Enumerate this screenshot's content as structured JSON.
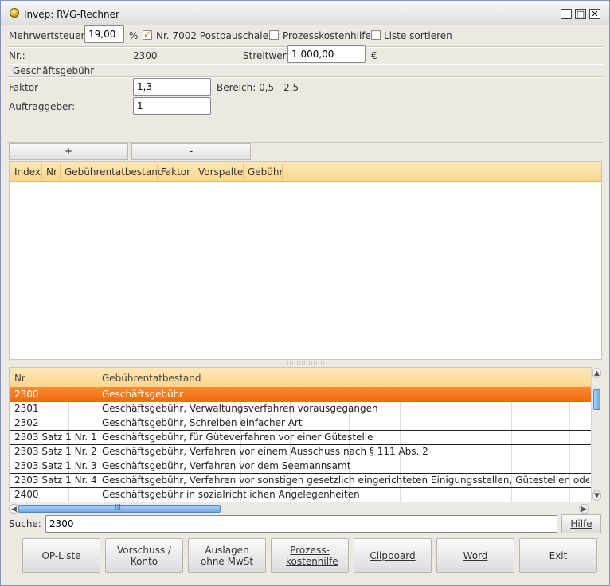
{
  "window": {
    "title": "Invep: RVG-Rechner",
    "minimize": "_",
    "maximize": "□",
    "close": "✕"
  },
  "top": {
    "mwst_label": "Mehrwertsteuer:",
    "mwst_value": "19,00",
    "percent": "%",
    "post_label": "Nr. 7002 Postpauschale",
    "post_checked": true,
    "pkh_label": "Prozesskostenhilfe",
    "sort_label": "Liste sortieren",
    "nr_label": "Nr.:",
    "nr_value": "2300",
    "streitwert_label": "Streitwert",
    "streitwert_value": "1.000,00",
    "currency": "€"
  },
  "section": {
    "title": "Geschäftsgebühr",
    "faktor_label": "Faktor",
    "faktor_value": "1,3",
    "bereich": "Bereich: 0,5 - 2,5",
    "auftraggeber_label": "Auftraggeber:",
    "auftraggeber_value": "1"
  },
  "controls": {
    "plus": "+",
    "minus": "-"
  },
  "upper_table": {
    "columns": [
      "Index",
      "Nr",
      "Gebührentatbestand",
      "Faktor",
      "Vorspalte",
      "Gebühr"
    ]
  },
  "lower_table": {
    "columns": [
      "Nr",
      "Gebührentatbestand"
    ],
    "rows": [
      {
        "nr": "2300",
        "desc": "Geschäftsgebühr",
        "selected": true
      },
      {
        "nr": "2301",
        "desc": "Geschäftsgebühr, Verwaltungsverfahren vorausgegangen"
      },
      {
        "nr": "2302",
        "desc": "Geschäftsgebühr, Schreiben einfacher Art"
      },
      {
        "nr": "2303 Satz 1 Nr. 1",
        "desc": "Geschäftsgebühr, für Güteverfahren vor einer Gütestelle"
      },
      {
        "nr": "2303 Satz 1 Nr. 2",
        "desc": "Geschäftsgebühr, Verfahren vor einem Ausschuss nach § 111 Abs. 2"
      },
      {
        "nr": "2303 Satz 1 Nr. 3",
        "desc": "Geschäftsgebühr, Verfahren vor dem Seemannsamt"
      },
      {
        "nr": "2303 Satz 1 Nr. 4",
        "desc": "Geschäftsgebühr, Verfahren vor sonstigen gesetzlich eingerichteten Einigungsstellen, Gütestellen oder Schie"
      },
      {
        "nr": "2400",
        "desc": "Geschäftsgebühr in sozialrichtlichen Angelegenheiten"
      }
    ]
  },
  "search": {
    "label": "Suche:",
    "value": "2300",
    "help": "Hilfe"
  },
  "buttons": {
    "op_liste": "OP-Liste",
    "vorschuss": "Vorschuss / Konto",
    "auslagen": "Auslagen ohne MwSt",
    "pkh": "Prozess-kostenhilfe",
    "clipboard": "Clipboard",
    "word": "Word",
    "exit": "Exit"
  },
  "colors": {
    "accent": "#f07018",
    "header": "#fbd68e"
  }
}
